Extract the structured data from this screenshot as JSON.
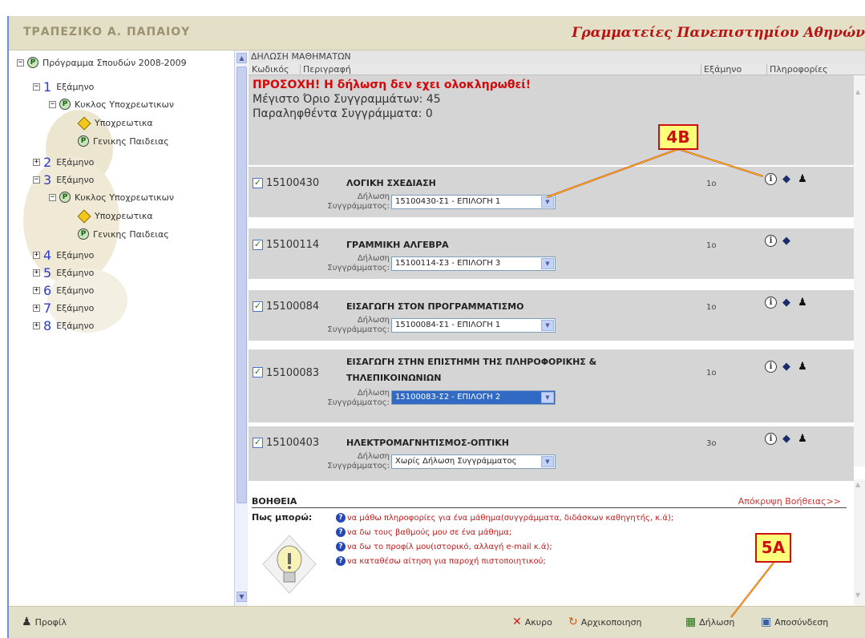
{
  "header": {
    "logo_text": "ΤΡΑΠΕΖΙΚΟ Α. ΠΑΠΑΙΟΥ",
    "title": "Γραμματείες Πανεπιστημίου Αθηνών"
  },
  "tree": {
    "root": "Πρόγραμμα Σπουδών 2008-2009",
    "semester_label": "Εξάμηνο",
    "cycle_label": "Κυκλος Υποχρεωτικων",
    "mandatory_label": "Υποχρεωτικα",
    "general_label": "Γενικης Παιδειας",
    "semesters": [
      "1",
      "2",
      "3",
      "4",
      "5",
      "6",
      "7",
      "8"
    ]
  },
  "main": {
    "section_title": "ΔΗΛΩΣΗ ΜΑΘΗΜΑΤΩΝ",
    "columns": [
      "Κωδικός",
      "Περιγραφή",
      "Εξάμηνο",
      "Πληροφορίες"
    ],
    "warning": "ΠΡΟΣΟΧΗ! Η δήλωση δεν εχει ολοκληρωθεί!",
    "max_books": "Μέγιστο Όριο Συγγραμμάτων: 45",
    "received_books": "Παραληφθέντα Συγγράμματα: 0",
    "decl_label_1": "Δήλωση",
    "decl_label_2": "Συγγράμματος:",
    "courses": [
      {
        "code": "15100430",
        "name": "ΛΟΓΙΚΗ ΣΧΕΔΙΑΣΗ",
        "name2": "",
        "semester": "1ο",
        "selection": "15100430-Σ1 - ΕΠΙΛΟΓΗ 1",
        "selected": false,
        "person": true
      },
      {
        "code": "15100114",
        "name": "ΓΡΑΜΜΙΚΗ ΑΛΓΕΒΡΑ",
        "name2": "",
        "semester": "1ο",
        "selection": "15100114-Σ3 - ΕΠΙΛΟΓΗ 3",
        "selected": false,
        "person": false
      },
      {
        "code": "15100084",
        "name": "ΕΙΣΑΓΩΓΗ ΣΤΟΝ ΠΡΟΓΡΑΜΜΑΤΙΣΜΟ",
        "name2": "",
        "semester": "1ο",
        "selection": "15100084-Σ1 - ΕΠΙΛΟΓΗ 1",
        "selected": false,
        "person": true
      },
      {
        "code": "15100083",
        "name": "ΕΙΣΑΓΩΓΗ ΣΤΗΝ ΕΠΙΣΤΗΜΗ ΤΗΣ ΠΛΗΡΟΦΟΡΙΚΗΣ &",
        "name2": "ΤΗΛΕΠΙΚΟΙΝΩΝΙΩΝ",
        "semester": "1ο",
        "selection": "15100083-Σ2 - ΕΠΙΛΟΓΗ 2",
        "selected": true,
        "person": true
      },
      {
        "code": "15100403",
        "name": "ΗΛΕΚΤΡΟΜΑΓΝΗΤΙΣΜΟΣ-ΟΠΤΙΚΗ",
        "name2": "",
        "semester": "3ο",
        "selection": "Χωρίς Δήλωση Συγγράμματος",
        "selected": false,
        "person": true
      }
    ]
  },
  "help": {
    "title": "ΒΟΗΘΕΙΑ",
    "hide_link": "Απόκρυψη Βοήθειας>>",
    "how_label": "Πως μπορώ:",
    "items": [
      "να μάθω πληροφορίες για ένα μάθημα(συγγράμματα, διδάσκων καθηγητής, κ.ά);",
      "να δω τους βαθμούς μου σε ένα μάθημα;",
      "να δω το προφίλ μου(ιστορικό, αλλαγή e-mail κ.ά);",
      "να καταθέσω αίτηση για παροχή πιστοποιητικού;"
    ]
  },
  "footer": {
    "profile": "Προφίλ",
    "cancel": "Ακυρο",
    "reset": "Αρχικοποιηση",
    "declare": "Δήλωση",
    "logout": "Αποσύνδεση"
  },
  "annotations": {
    "a1": "4B",
    "a2": "5A"
  },
  "colors": {
    "accent_red": "#cc0f0f",
    "header_bg": "#e3e0c7",
    "row_bg": "#d5d5d5",
    "link_blue": "#2b3ccf"
  }
}
